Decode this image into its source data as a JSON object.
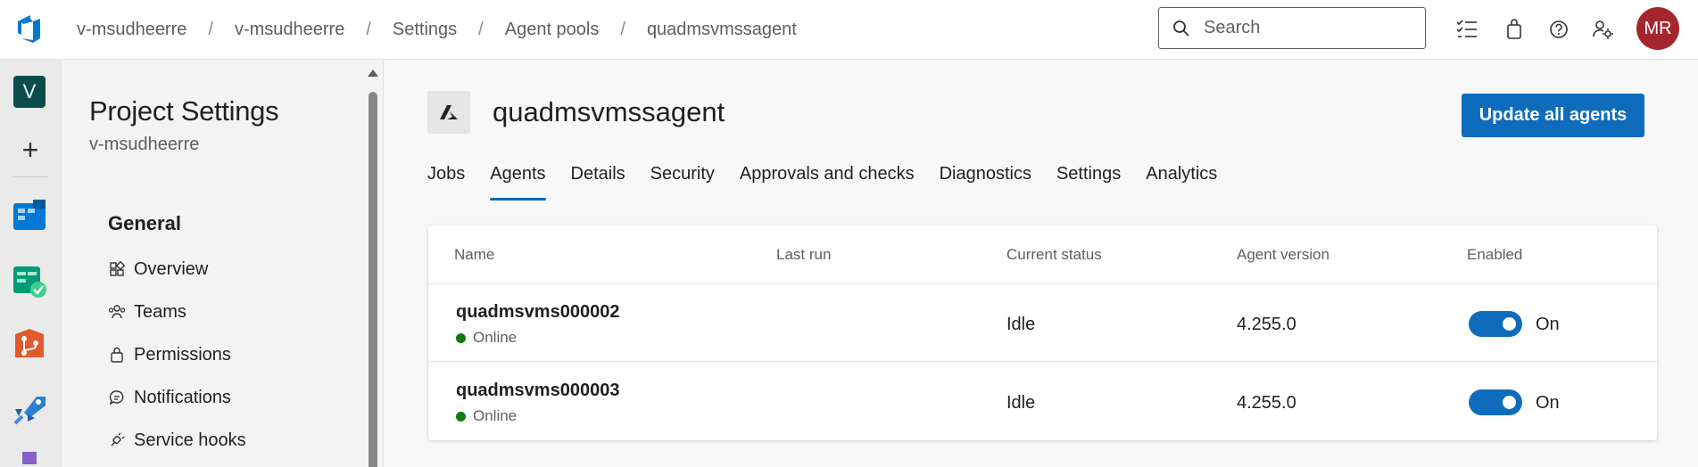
{
  "breadcrumb": [
    "v-msudheerre",
    "v-msudheerre",
    "Settings",
    "Agent pools",
    "quadmsvmssagent"
  ],
  "search": {
    "placeholder": "Search"
  },
  "topbar_icons": [
    "task-list-icon",
    "shopping-bag-icon",
    "help-icon",
    "user-settings-icon"
  ],
  "user": {
    "initials": "MR",
    "avatar_color": "#a4262c"
  },
  "rail": {
    "project_initial": "V",
    "project_color": "#0b4d4a",
    "services": [
      "boards-icon",
      "test-plans-icon",
      "repos-icon",
      "pipelines-icon",
      "artifacts-icon"
    ]
  },
  "sidebar": {
    "title": "Project Settings",
    "subtitle": "v-msudheerre",
    "group": "General",
    "items": [
      {
        "label": "Overview",
        "icon": "overview-icon"
      },
      {
        "label": "Teams",
        "icon": "teams-icon"
      },
      {
        "label": "Permissions",
        "icon": "lock-icon"
      },
      {
        "label": "Notifications",
        "icon": "chat-bubble-icon"
      },
      {
        "label": "Service hooks",
        "icon": "plug-icon"
      }
    ]
  },
  "pool": {
    "name": "quadmsvmssagent",
    "icon": "azure-icon",
    "update_button": "Update all agents",
    "accent_color": "#0f6cbd"
  },
  "tabs": [
    {
      "label": "Jobs",
      "active": false
    },
    {
      "label": "Agents",
      "active": true
    },
    {
      "label": "Details",
      "active": false
    },
    {
      "label": "Security",
      "active": false
    },
    {
      "label": "Approvals and checks",
      "active": false
    },
    {
      "label": "Diagnostics",
      "active": false
    },
    {
      "label": "Settings",
      "active": false
    },
    {
      "label": "Analytics",
      "active": false
    }
  ],
  "table": {
    "columns": [
      "Name",
      "Last run",
      "Current status",
      "Agent version",
      "Enabled"
    ],
    "rows": [
      {
        "name": "quadmsvms000002",
        "online": "Online",
        "last_run": "",
        "status": "Idle",
        "version": "4.255.0",
        "enabled": "On"
      },
      {
        "name": "quadmsvms000003",
        "online": "Online",
        "last_run": "",
        "status": "Idle",
        "version": "4.255.0",
        "enabled": "On"
      }
    ],
    "online_color": "#107c10"
  }
}
